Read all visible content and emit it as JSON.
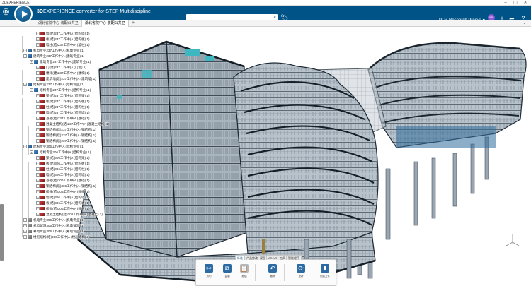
{
  "window": {
    "title": "3DEXPERIENCE",
    "minimize_icon": "minimize-icon",
    "maximize_icon": "maximize-icon",
    "close_icon": "close-icon"
  },
  "header": {
    "app_name_bold": "3D",
    "app_name_rest": "EXPERIENCE",
    "app_subtitle": "converter for STEP Multidiscipline",
    "search": {
      "value": "",
      "placeholder": ""
    },
    "user_small": "",
    "project": "PLM Research Project ▾",
    "compass_label": "",
    "colors": {
      "header_bg": "#005386",
      "accent": "#8f5bd6"
    }
  },
  "tabs": [
    {
      "label": "湖北省院中心-装配公共卫"
    },
    {
      "label": "湖北省院中心-装配公共卫"
    }
  ],
  "tree": {
    "rows": [
      "墙(结)237工作中(A (结构墙).1)",
      "板(结)237工作中(A (结构板).1)",
      "墙柱(结)237工作中(A (墙柱).1)",
      "机电专业237工作中(A (机电专业).1)",
      "建筑专业237工作中(A (建筑专业).1)",
      "建筑专业237工作中(A (建筑专业).1)",
      "门(建)237工作中(A (门窗).1)",
      "楼梯(建)237工作中(A (楼梯).1)",
      "建筑墙(建)237工作中(A (建筑墙).1)",
      "结构专业237工作中(A (结构专业).1)",
      "结构专业237工作中(A (结构专业).1)",
      "梁(结)237工作中(A (结构梁).1)",
      "板(结)237工作中(A (结构板).1)",
      "柱(结)237工作中(A (结构柱).1)",
      "墙(结)237工作中(A (结构墙).1)",
      "基础(结)237工作中(A (基础).1)",
      "混凝土结构(结)237工作中(A (混凝土结构).1)",
      "钢结构(结)237工作中(A (钢结构).1)",
      "钢结构(结)237工作中(A (钢结构).1)",
      "钢结构(结)237工作中(A (钢结构).1)",
      "结构专业306工作中(A (结构专业).1)",
      "结构专业306工作中(A (结构专业).1)",
      "梁(结)306工作中(A (结构梁).1)",
      "板(结)306工作中(A (结构板).1)",
      "柱(结)306工作中(A (结构柱).1)",
      "墙(结)306工作中(A (结构墙).1)",
      "基础(结)306工作中(A (基础).1)",
      "钢结构(结)306工作中(A (钢结构).1)",
      "楼梯(结)306工作中(A (楼梯).1)",
      "墙(结)306工作中(A (结构墙).1)",
      "板(结)306工作中(A (结构板).1)",
      "楼板(结)306工作中(A (楼板).1)",
      "混凝土结构(结)306工作中(A (混凝土).1)",
      "机电专业306工作中(A (机电专业).1)",
      "机电留洞306工作中(A (机电留洞).1)",
      "幕墙专业306工作中(A (幕墙专业).1)",
      "楼层结构(结)306工作中(A (楼层结构).1)"
    ]
  },
  "actionbar": {
    "tabs": [
      "标准",
      "产品修改",
      "视图",
      "AR-VR",
      "工具",
      "智能程序"
    ],
    "buttons": [
      {
        "label": "剪切",
        "icon": "scissors-icon"
      },
      {
        "label": "复制",
        "icon": "copy-icon"
      },
      {
        "label": "粘贴",
        "icon": "paste-icon"
      },
      {
        "label": "撤消",
        "icon": "undo-icon"
      },
      {
        "label": "更新",
        "icon": "update-icon"
      },
      {
        "label": "创建文件",
        "icon": "create-file-icon"
      }
    ]
  }
}
